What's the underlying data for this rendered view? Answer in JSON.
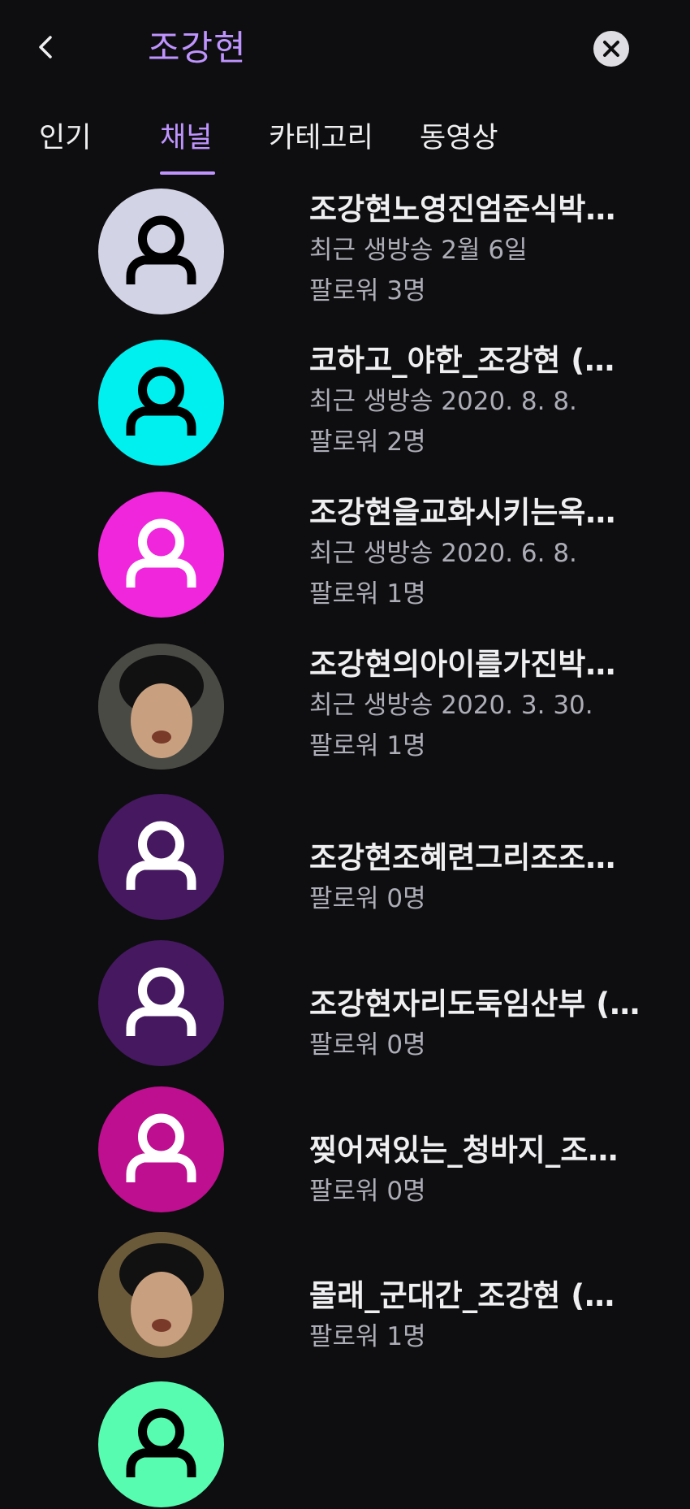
{
  "header": {
    "title": "조강현",
    "back_icon": "chevron-left-icon",
    "clear_icon": "close-circle-icon"
  },
  "tabs": [
    {
      "label": "인기",
      "active": false
    },
    {
      "label": "채널",
      "active": true
    },
    {
      "label": "카테고리",
      "active": false
    },
    {
      "label": "동영상",
      "active": false
    }
  ],
  "colors": {
    "accent": "#bf94ff",
    "background": "#0e0e10"
  },
  "channels": [
    {
      "name": "조강현노영진엄준식박…",
      "last_live": "최근 생방송 2월 6일",
      "followers": "팔로워 3명",
      "avatar_type": "default",
      "avatar_bg": "#d3d3e6",
      "icon_color": "#000000"
    },
    {
      "name": "코하고_야한_조강현 (…",
      "last_live": "최근 생방송 2020. 8. 8.",
      "followers": "팔로워 2명",
      "avatar_type": "default",
      "avatar_bg": "#00f0f0",
      "icon_color": "#000000"
    },
    {
      "name": "조강현을교화시키는옥…",
      "last_live": "최근 생방송 2020. 6. 8.",
      "followers": "팔로워 1명",
      "avatar_type": "default",
      "avatar_bg": "#f026dc",
      "icon_color": "#ffffff"
    },
    {
      "name": "조강현의아이를가진박…",
      "last_live": "최근 생방송 2020. 3. 30.",
      "followers": "팔로워 1명",
      "avatar_type": "photo",
      "avatar_bg": "#4a4a44",
      "icon_color": "#000000"
    },
    {
      "name": "조강현조혜련그리조조…",
      "last_live": "",
      "followers": "팔로워 0명",
      "avatar_type": "default",
      "avatar_bg": "#451860",
      "icon_color": "#ffffff"
    },
    {
      "name": "조강현자리도둑임산부 (…",
      "last_live": "",
      "followers": "팔로워 0명",
      "avatar_type": "default",
      "avatar_bg": "#451860",
      "icon_color": "#ffffff"
    },
    {
      "name": "찢어져있는_청바지_조…",
      "last_live": "",
      "followers": "팔로워 0명",
      "avatar_type": "default",
      "avatar_bg": "#bd0f8f",
      "icon_color": "#ffffff"
    },
    {
      "name": "몰래_군대간_조강현 (…",
      "last_live": "",
      "followers": "팔로워 1명",
      "avatar_type": "photo",
      "avatar_bg": "#6b5a3a",
      "icon_color": "#000000"
    },
    {
      "name": "",
      "last_live": "",
      "followers": "",
      "avatar_type": "default",
      "avatar_bg": "#57fcb0",
      "icon_color": "#000000"
    }
  ]
}
